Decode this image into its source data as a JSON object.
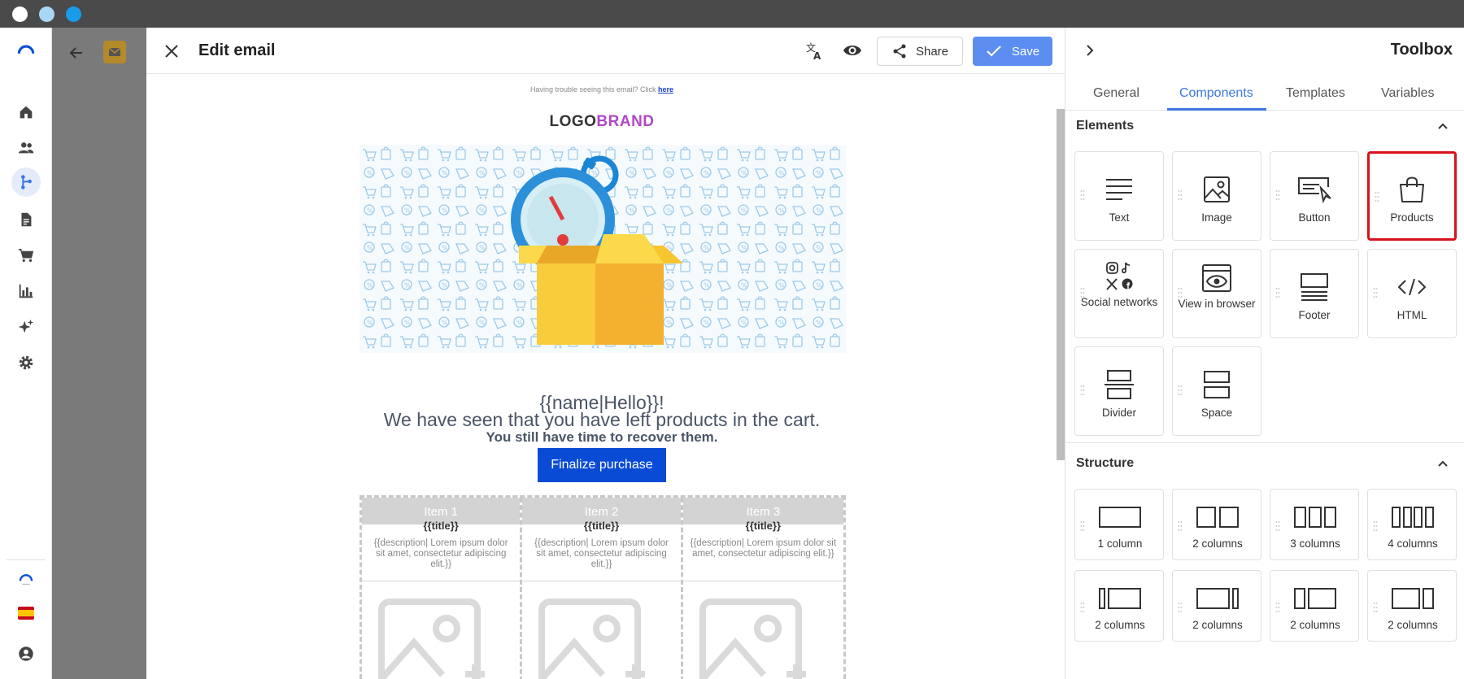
{
  "colors": {
    "accent": "#3b76e0",
    "save_button": "#5b8ef0",
    "cta_button": "#0a4bd6",
    "highlight_border": "#d8121b",
    "brand_purple": "#b147c9"
  },
  "window": {
    "dots": [
      {
        "name": "window-dot-close",
        "color": "#ffffff"
      },
      {
        "name": "window-dot-minimize",
        "color": "#a8d8f5"
      },
      {
        "name": "window-dot-maximize",
        "color": "#1a9bea"
      }
    ]
  },
  "sidebar": {
    "items": [
      {
        "icon": "home-icon"
      },
      {
        "icon": "contacts-icon"
      },
      {
        "icon": "automation-flow-icon",
        "active": true
      },
      {
        "icon": "document-icon"
      },
      {
        "icon": "shopping-cart-icon"
      },
      {
        "icon": "bar-chart-icon"
      },
      {
        "icon": "sparkles-icon"
      },
      {
        "icon": "settings-icon"
      }
    ],
    "bottom": [
      {
        "icon": "brand-logo-icon"
      },
      {
        "icon": "spain-flag-icon"
      },
      {
        "icon": "account-icon"
      }
    ]
  },
  "editor": {
    "title": "Edit email",
    "share_label": "Share",
    "save_label": "Save"
  },
  "email": {
    "trouble_text": "Having trouble seeing this email? Click",
    "trouble_link": "here",
    "logo_part1": "LOGO",
    "logo_part2": "BRAND",
    "greeting": "{{name|Hello}}!",
    "line1": "We have seen that you have left products in the cart.",
    "line2": "You still have time to recover them.",
    "cta": "Finalize purchase",
    "items": [
      {
        "label": "Item 1",
        "title": "{{title}}",
        "description": "{{description| Lorem ipsum dolor sit amet, consectetur adipiscing elit.}}"
      },
      {
        "label": "Item 2",
        "title": "{{title}}",
        "description": "{{description| Lorem ipsum dolor sit amet, consectetur adipiscing elit.}}"
      },
      {
        "label": "Item 3",
        "title": "{{title}}",
        "description": "{{description| Lorem ipsum dolor sit amet, consectetur adipiscing elit.}}"
      }
    ]
  },
  "toolbox": {
    "title": "Toolbox",
    "tabs": [
      "General",
      "Components",
      "Templates",
      "Variables"
    ],
    "active_tab": "Components",
    "elements_title": "Elements",
    "elements": [
      {
        "label": "Text",
        "icon": "text-icon"
      },
      {
        "label": "Image",
        "icon": "image-icon"
      },
      {
        "label": "Button",
        "icon": "button-icon"
      },
      {
        "label": "Products",
        "icon": "shopping-bag-icon",
        "highlighted": true
      },
      {
        "label": "Social networks",
        "icon": "social-networks-icon"
      },
      {
        "label": "View in browser",
        "icon": "view-in-browser-icon"
      },
      {
        "label": "Footer",
        "icon": "footer-icon"
      },
      {
        "label": "HTML",
        "icon": "code-icon"
      },
      {
        "label": "Divider",
        "icon": "divider-icon"
      },
      {
        "label": "Space",
        "icon": "space-icon"
      }
    ],
    "structure_title": "Structure",
    "structure": [
      {
        "label": "1 column",
        "icon": "layout-1-column-icon"
      },
      {
        "label": "2 columns",
        "icon": "layout-2-columns-icon"
      },
      {
        "label": "3 columns",
        "icon": "layout-3-columns-icon"
      },
      {
        "label": "4 columns",
        "icon": "layout-4-columns-icon"
      },
      {
        "label": "2 columns",
        "icon": "layout-narrow-left-icon"
      },
      {
        "label": "2 columns",
        "icon": "layout-narrow-right-icon"
      },
      {
        "label": "2 columns",
        "icon": "layout-third-left-icon"
      },
      {
        "label": "2 columns",
        "icon": "layout-third-right-icon"
      }
    ]
  }
}
